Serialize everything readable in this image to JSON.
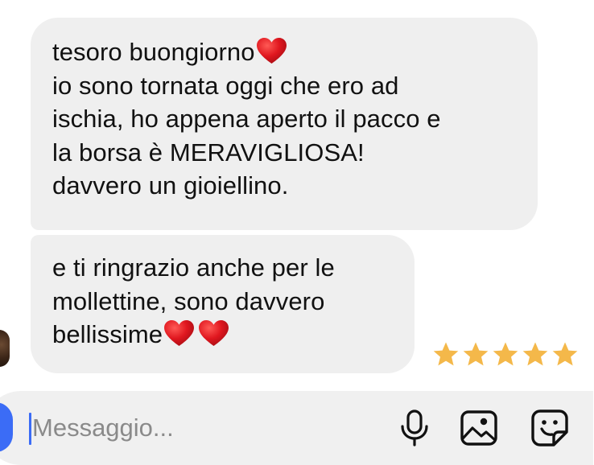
{
  "conversation": {
    "messages": [
      {
        "lines": [
          "tesoro buongiorno",
          "io sono tornata oggi che ero ad",
          "ischia, ho appena aperto il pacco e",
          "la borsa è MERAVIGLIOSA!",
          "davvero un gioiellino."
        ],
        "emoji": [
          "red-heart"
        ]
      },
      {
        "lines": [
          "e ti ringrazio anche per le",
          "mollettine, sono davvero",
          "bellissime"
        ],
        "emoji": [
          "red-heart",
          "red-heart"
        ]
      }
    ],
    "rating": {
      "stars": 5,
      "max": 5,
      "color": "#f4b84a"
    }
  },
  "composer": {
    "placeholder": "Messaggio...",
    "value": "",
    "icons": [
      "camera-icon",
      "microphone-icon",
      "image-gallery-icon",
      "sticker-icon"
    ]
  },
  "colors": {
    "bubble": "#efefef",
    "heart": "#e0171f",
    "accent": "#3b6cf6",
    "composer": "#f0f0f0"
  }
}
